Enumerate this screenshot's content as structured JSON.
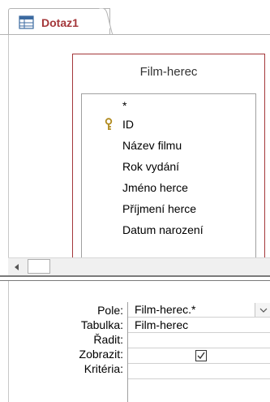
{
  "tab": {
    "label": "Dotaz1",
    "icon": "query-table-icon",
    "accent_color": "#a4373a"
  },
  "table": {
    "title": "Film-herec",
    "fields": [
      {
        "label": "*",
        "primary_key": false
      },
      {
        "label": "ID",
        "primary_key": true
      },
      {
        "label": "Název filmu",
        "primary_key": false
      },
      {
        "label": "Rok vydání",
        "primary_key": false
      },
      {
        "label": "Jméno herce",
        "primary_key": false
      },
      {
        "label": "Příjmení herce",
        "primary_key": false
      },
      {
        "label": "Datum narození",
        "primary_key": false
      }
    ]
  },
  "grid": {
    "rows": [
      "Pole:",
      "Tabulka:",
      "Řadit:",
      "Zobrazit:",
      "Kritéria:"
    ],
    "column": {
      "field": "Film-herec.*",
      "table": "Film-herec",
      "sort": "",
      "show": true,
      "criteria": ""
    }
  }
}
